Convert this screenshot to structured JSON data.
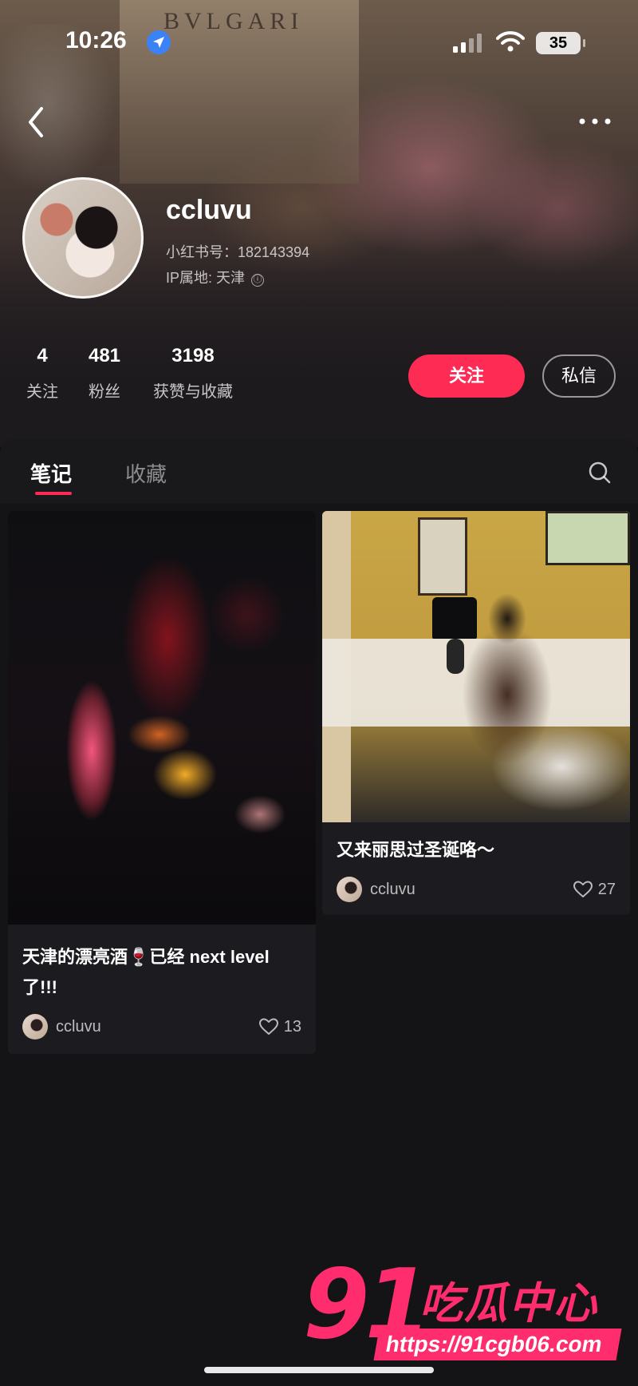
{
  "status_bar": {
    "time": "10:26",
    "battery": "35"
  },
  "profile": {
    "username": "ccluvu",
    "id_label": "小红书号：182143394",
    "ip_label": "IP属地: 天津",
    "info_icon": "ⓘ"
  },
  "stats": [
    {
      "value": "4",
      "label": "关注"
    },
    {
      "value": "481",
      "label": "粉丝"
    },
    {
      "value": "3198",
      "label": "获赞与收藏"
    }
  ],
  "actions": {
    "follow": "关注",
    "message": "私信"
  },
  "tabs": [
    {
      "label": "笔记",
      "active": true
    },
    {
      "label": "收藏",
      "active": false
    }
  ],
  "notes": [
    {
      "title": "天津的漂亮酒🍷已经 next level了!!!",
      "author": "ccluvu",
      "likes": "13"
    },
    {
      "title": "又来丽思过圣诞咯～",
      "author": "ccluvu",
      "likes": "27"
    }
  ],
  "watermark": {
    "logo_number": "91",
    "logo_text": "吃瓜中心",
    "url": "https://91cgb06.com"
  },
  "image_text": {
    "store_sign": "BVLGARI"
  },
  "colors": {
    "accent": "#fe2c55",
    "watermark": "#ff2d6e",
    "background": "#111113"
  },
  "icons": [
    "location-icon",
    "signal-icon",
    "wifi-icon",
    "battery-icon",
    "back-icon",
    "more-icon",
    "search-icon",
    "heart-icon"
  ]
}
